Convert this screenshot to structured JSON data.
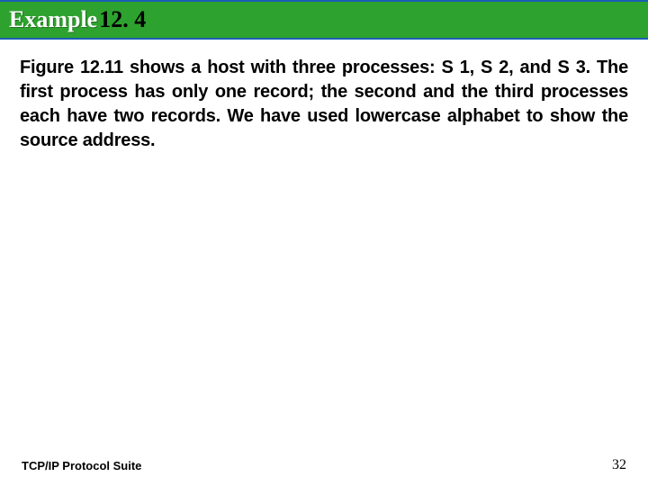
{
  "header": {
    "title_prefix": "Example",
    "title_suffix": " 12. 4"
  },
  "body": {
    "paragraph": "Figure 12.11 shows a host with three processes: S 1, S 2, and S 3. The first process has only one record; the second and the third processes each have two records. We have used lowercase alphabet to show the source address."
  },
  "footer": {
    "left": "TCP/IP Protocol Suite",
    "page_number": "32"
  }
}
